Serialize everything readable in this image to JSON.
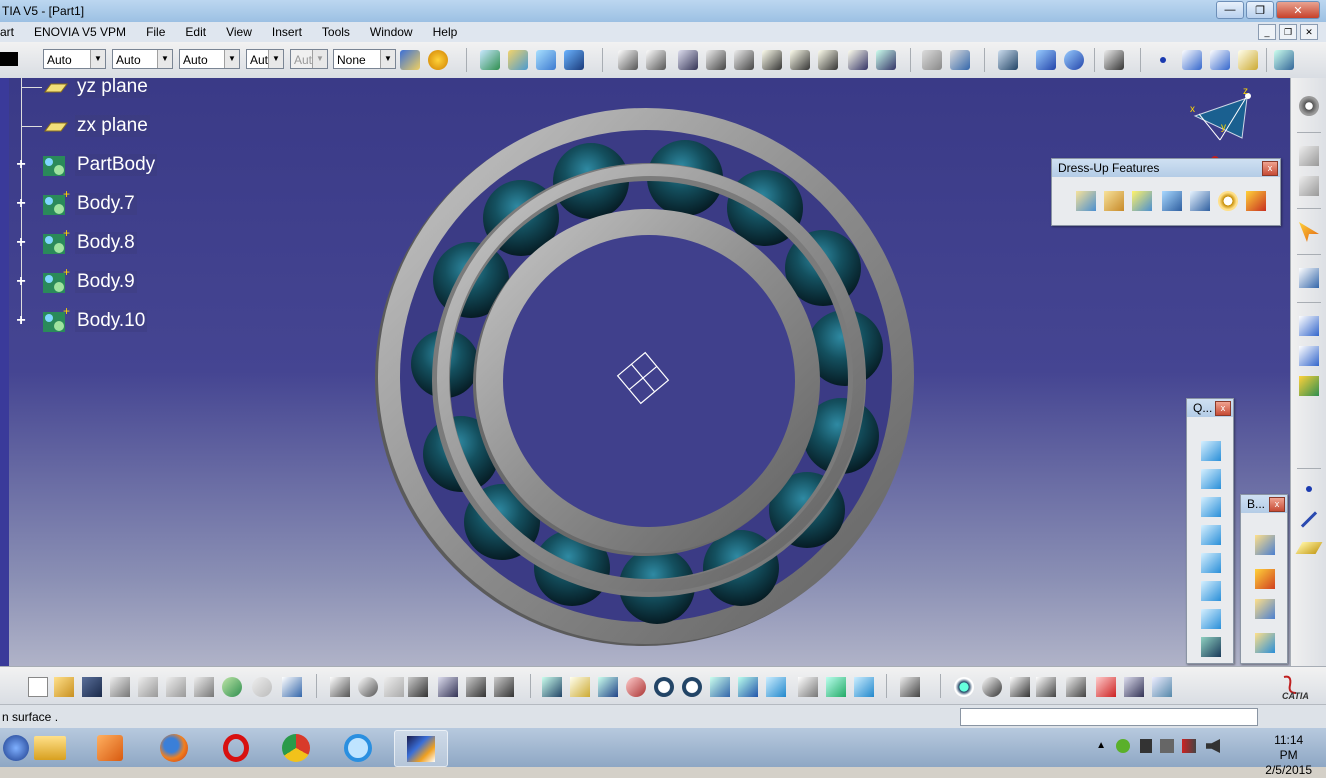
{
  "window": {
    "title": "TIA V5 - [Part1]",
    "btn_minimize": "—",
    "btn_restore": "❐",
    "btn_close": "✕"
  },
  "menu": {
    "items": [
      "art",
      "ENOVIA V5 VPM",
      "File",
      "Edit",
      "View",
      "Insert",
      "Tools",
      "Window",
      "Help"
    ],
    "mdi_minimize": "_",
    "mdi_restore": "❐",
    "mdi_close": "✕"
  },
  "toolbar": {
    "combos": [
      {
        "value": "Auto",
        "disabled": false
      },
      {
        "value": "Auto",
        "disabled": false
      },
      {
        "value": "Auto",
        "disabled": false
      },
      {
        "value": "Aut",
        "disabled": false
      },
      {
        "value": "Aut",
        "disabled": true
      },
      {
        "value": "None",
        "disabled": false
      }
    ],
    "combo_arrow": "▼"
  },
  "tree": {
    "nodes": [
      {
        "label": "yz plane",
        "icon": "plane-icon",
        "expandable": false
      },
      {
        "label": "zx plane",
        "icon": "plane-icon",
        "expandable": false
      },
      {
        "label": "PartBody",
        "icon": "body-icon",
        "expandable": true
      },
      {
        "label": "Body.7",
        "icon": "body-icon",
        "expandable": true
      },
      {
        "label": "Body.8",
        "icon": "body-icon",
        "expandable": true
      },
      {
        "label": "Body.9",
        "icon": "body-icon",
        "expandable": true
      },
      {
        "label": "Body.10",
        "icon": "body-icon",
        "expandable": true
      }
    ],
    "expand_glyph": "+"
  },
  "compass": {
    "x_label": "x",
    "y_label": "y",
    "z_label": "z"
  },
  "palettes": {
    "dressup": {
      "title": "Dress-Up Features",
      "close": "x"
    },
    "quick": {
      "title": "Q...",
      "close": "x"
    },
    "boolean": {
      "title": "B...",
      "close": "x"
    }
  },
  "status": {
    "message": "n surface ."
  },
  "brand": {
    "logo_text": "CATIA"
  },
  "taskbar": {
    "time": "11:14 PM",
    "date": "2/5/2015"
  },
  "colors": {
    "viewport_top": "#3a3a87",
    "ring": "#9a9a9a",
    "ball": "#0f3a4a"
  }
}
